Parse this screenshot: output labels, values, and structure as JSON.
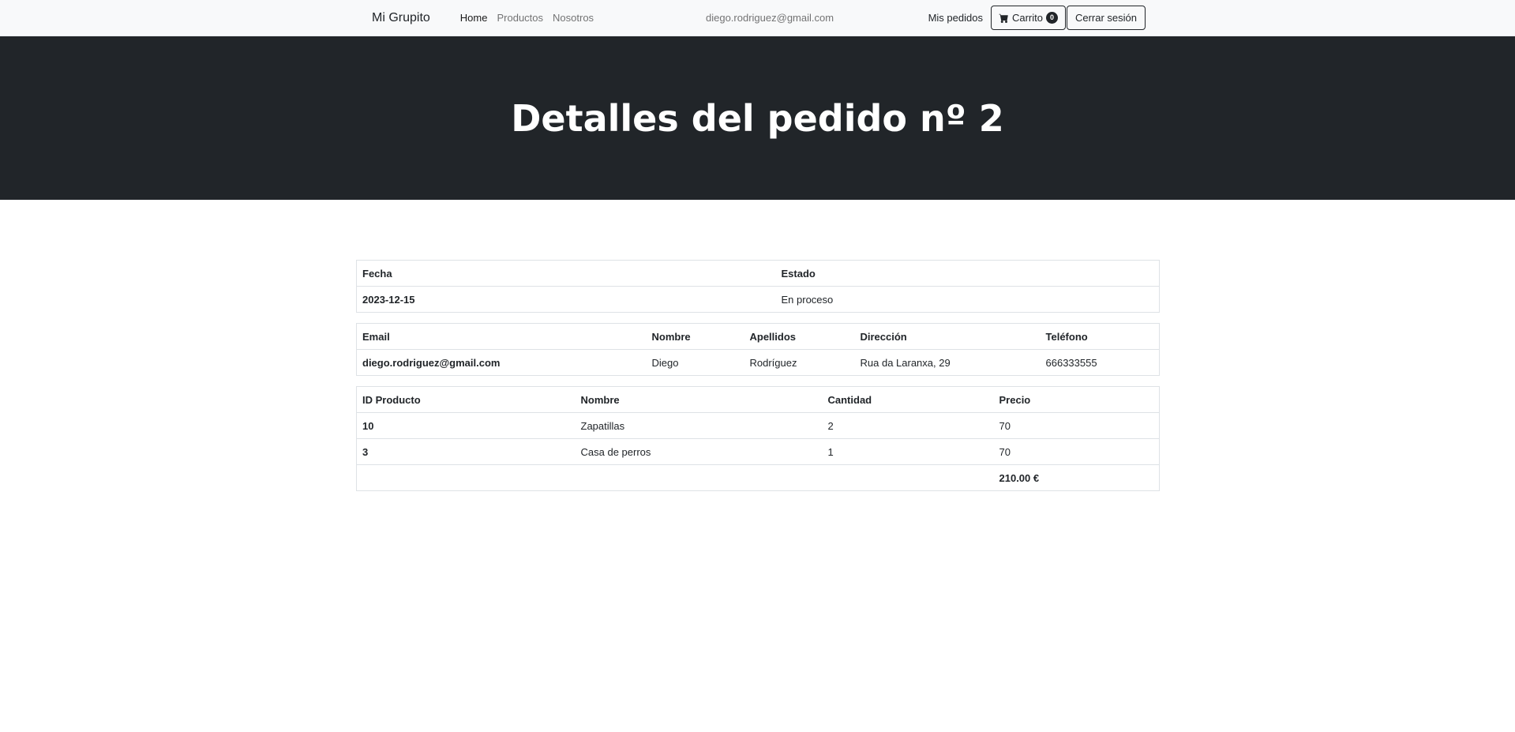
{
  "navbar": {
    "brand": "Mi Grupito",
    "links": [
      "Home",
      "Productos",
      "Nosotros"
    ],
    "user_email": "diego.rodriguez@gmail.com",
    "my_orders": "Mis pedidos",
    "cart_label": "Carrito",
    "cart_count": "0",
    "cart_icon": "cart-icon",
    "logout_label": "Cerrar sesión"
  },
  "hero": {
    "title": "Detalles del pedido nº 2"
  },
  "order": {
    "headers": [
      "Fecha",
      "Estado"
    ],
    "date": "2023-12-15",
    "status": "En proceso"
  },
  "customer": {
    "headers": [
      "Email",
      "Nombre",
      "Apellidos",
      "Dirección",
      "Teléfono"
    ],
    "email": "diego.rodriguez@gmail.com",
    "name": "Diego",
    "surname": "Rodríguez",
    "address": "Rua da Laranxa, 29",
    "phone": "666333555"
  },
  "products": {
    "headers": [
      "ID Producto",
      "Nombre",
      "Cantidad",
      "Precio"
    ],
    "rows": [
      {
        "id": "10",
        "name": "Zapatillas",
        "qty": "2",
        "price": "70"
      },
      {
        "id": "3",
        "name": "Casa de perros",
        "qty": "1",
        "price": "70"
      }
    ],
    "total": "210.00 €"
  },
  "colors": {
    "navbar_bg": "#f8f9fa",
    "hero_bg": "#212529",
    "text": "#212529",
    "border": "#dee2e6"
  }
}
